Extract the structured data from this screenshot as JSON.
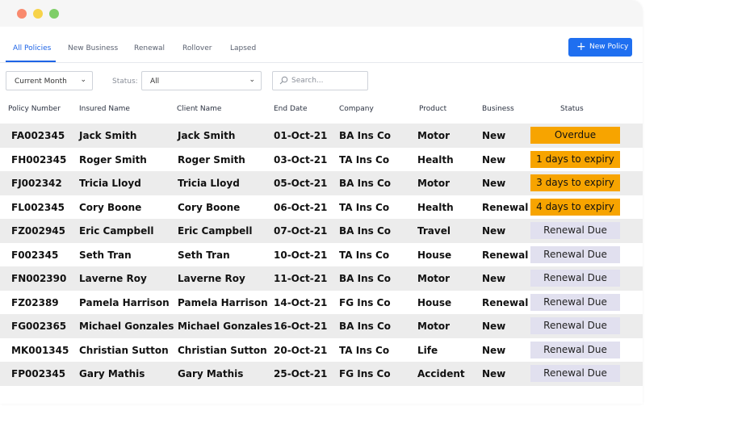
{
  "tabs": [
    {
      "label": "All Policies",
      "active": true
    },
    {
      "label": "New Business"
    },
    {
      "label": "Renewal"
    },
    {
      "label": "Rollover"
    },
    {
      "label": "Lapsed"
    }
  ],
  "new_policy_button": {
    "label": "New Policy",
    "icon": "plus-icon"
  },
  "filters": {
    "period": "Current Month",
    "status_label": "Status:",
    "status_value": "All",
    "search_placeholder": "Search..."
  },
  "columns": [
    "Policy Number",
    "Insured Name",
    "Client Name",
    "End Date",
    "Company",
    "Product",
    "Business",
    "Status"
  ],
  "rows": [
    {
      "policy": "FA002345",
      "insured": "Jack Smith",
      "client": "Jack Smith",
      "end": "01-Oct-21",
      "company": "BA Ins Co",
      "product": "Motor",
      "business": "New",
      "status": "Overdue",
      "status_kind": "urgent"
    },
    {
      "policy": "FH002345",
      "insured": "Roger Smith",
      "client": "Roger Smith",
      "end": "03-Oct-21",
      "company": "TA Ins Co",
      "product": "Health",
      "business": "New",
      "status": "1 days to expiry",
      "status_kind": "urgent"
    },
    {
      "policy": "FJ002342",
      "insured": "Tricia Lloyd",
      "client": "Tricia Lloyd",
      "end": "05-Oct-21",
      "company": "BA Ins Co",
      "product": "Motor",
      "business": "New",
      "status": "3 days to expiry",
      "status_kind": "urgent"
    },
    {
      "policy": "FL002345",
      "insured": "Cory Boone",
      "client": "Cory Boone",
      "end": "06-Oct-21",
      "company": "TA Ins Co",
      "product": "Health",
      "business": "Renewal",
      "status": "4 days to expiry",
      "status_kind": "urgent"
    },
    {
      "policy": "FZ002945",
      "insured": "Eric Campbell",
      "client": "Eric Campbell",
      "end": "07-Oct-21",
      "company": "BA Ins Co",
      "product": "Travel",
      "business": "New",
      "status": "Renewal Due",
      "status_kind": "due"
    },
    {
      "policy": "F002345",
      "insured": "Seth Tran",
      "client": "Seth Tran",
      "end": "10-Oct-21",
      "company": "TA Ins Co",
      "product": "House",
      "business": "Renewal",
      "status": "Renewal Due",
      "status_kind": "due"
    },
    {
      "policy": "FN002390",
      "insured": "Laverne Roy",
      "client": "Laverne Roy",
      "end": "11-Oct-21",
      "company": "BA Ins Co",
      "product": "Motor",
      "business": "New",
      "status": "Renewal Due",
      "status_kind": "due"
    },
    {
      "policy": "FZ02389",
      "insured": "Pamela Harrison",
      "client": "Pamela Harrison",
      "end": "14-Oct-21",
      "company": "FG Ins Co",
      "product": "House",
      "business": "Renewal",
      "status": "Renewal Due",
      "status_kind": "due"
    },
    {
      "policy": "FG002365",
      "insured": "Michael Gonzales",
      "client": "Michael Gonzales",
      "end": "16-Oct-21",
      "company": "BA Ins Co",
      "product": "Motor",
      "business": "New",
      "status": "Renewal Due",
      "status_kind": "due"
    },
    {
      "policy": "MK001345",
      "insured": "Christian Sutton",
      "client": "Christian Sutton",
      "end": "20-Oct-21",
      "company": "TA Ins Co",
      "product": "Life",
      "business": "New",
      "status": "Renewal Due",
      "status_kind": "due"
    },
    {
      "policy": "FP002345",
      "insured": "Gary Mathis",
      "client": "Gary Mathis",
      "end": "25-Oct-21",
      "company": "FG Ins Co",
      "product": "Accident",
      "business": "New",
      "status": "Renewal Due",
      "status_kind": "due"
    }
  ],
  "colors": {
    "accent": "#1f6ff0",
    "urgent": "#f7a400",
    "due": "#e1e0ef"
  }
}
